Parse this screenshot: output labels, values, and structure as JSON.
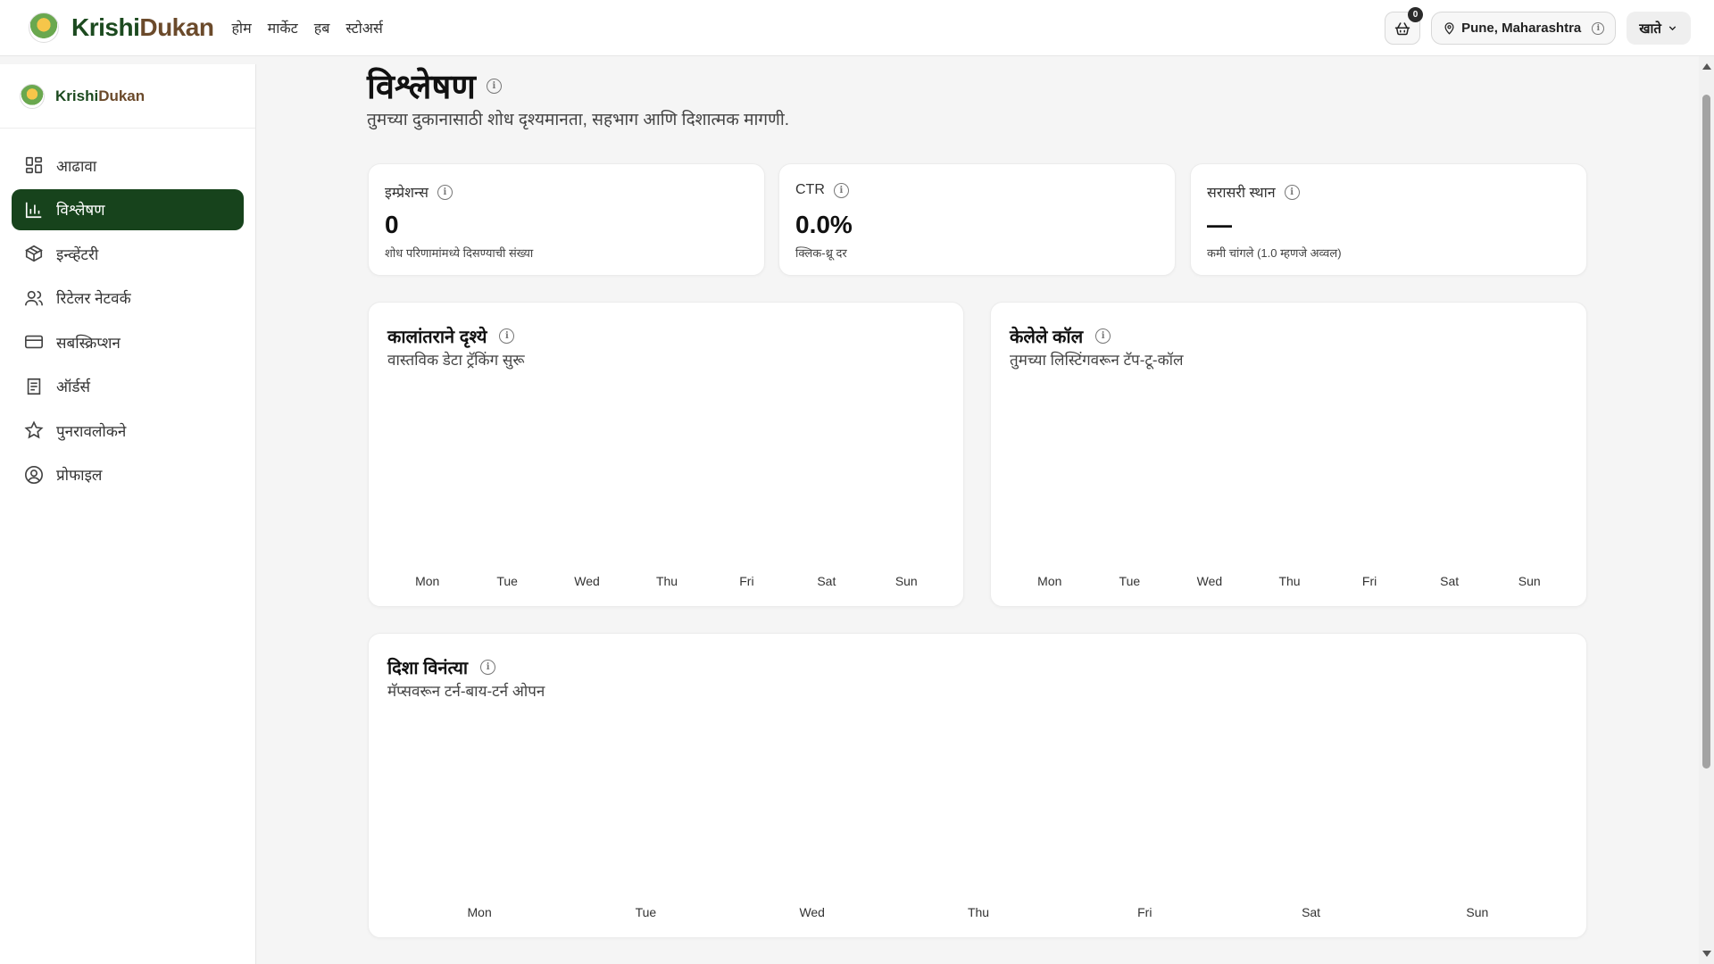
{
  "header": {
    "brand_krishi": "Krishi",
    "brand_dukan": "Dukan",
    "nav": [
      "होम",
      "मार्केट",
      "हब",
      "स्टोअर्स"
    ],
    "cart_count": "0",
    "location": "Pune, Maharashtra",
    "account_label": "खाते"
  },
  "sidebar": {
    "brand_krishi": "Krishi",
    "brand_dukan": "Dukan",
    "items": [
      {
        "label": "आढावा",
        "icon": "grid-icon"
      },
      {
        "label": "विश्लेषण",
        "icon": "bar-chart-icon",
        "active": true
      },
      {
        "label": "इन्व्हेंटरी",
        "icon": "box-icon"
      },
      {
        "label": "रिटेलर नेटवर्क",
        "icon": "users-icon"
      },
      {
        "label": "सबस्क्रिप्शन",
        "icon": "credit-card-icon"
      },
      {
        "label": "ऑर्डर्स",
        "icon": "document-icon"
      },
      {
        "label": "पुनरावलोकने",
        "icon": "star-icon"
      },
      {
        "label": "प्रोफाइल",
        "icon": "user-circle-icon"
      }
    ]
  },
  "page": {
    "title": "विश्लेषण",
    "subtitle": "तुमच्या दुकानासाठी शोध दृश्यमानता, सहभाग आणि दिशात्मक मागणी."
  },
  "stats": [
    {
      "label": "इम्प्रेशन्स",
      "value": "0",
      "note": "शोध परिणामांमध्ये दिसण्याची संख्या"
    },
    {
      "label": "CTR",
      "value": "0.0%",
      "note": "क्लिक-थ्रू दर"
    },
    {
      "label": "सरासरी स्थान",
      "value": "—",
      "note": "कमी चांगले (1.0 म्हणजे अव्वल)"
    }
  ],
  "chart_data": [
    {
      "type": "bar",
      "title": "कालांतराने दृश्ये",
      "subtitle": "वास्तविक डेटा ट्रॅकिंग सुरू",
      "categories": [
        "Mon",
        "Tue",
        "Wed",
        "Thu",
        "Fri",
        "Sat",
        "Sun"
      ],
      "values": [
        0,
        0,
        0,
        0,
        0,
        0,
        0
      ]
    },
    {
      "type": "bar",
      "title": "केलेले कॉल",
      "subtitle": "तुमच्या लिस्टिंगवरून टॅप-टू-कॉल",
      "categories": [
        "Mon",
        "Tue",
        "Wed",
        "Thu",
        "Fri",
        "Sat",
        "Sun"
      ],
      "values": [
        0,
        0,
        0,
        0,
        0,
        0,
        0
      ]
    },
    {
      "type": "bar",
      "title": "दिशा विनंत्या",
      "subtitle": "मॅप्सवरून टर्न-बाय-टर्न ओपन",
      "categories": [
        "Mon",
        "Tue",
        "Wed",
        "Thu",
        "Fri",
        "Sat",
        "Sun"
      ],
      "values": [
        0,
        0,
        0,
        0,
        0,
        0,
        0
      ]
    }
  ],
  "colors": {
    "active_bg": "#17431c",
    "brand_green": "#1c4a1f",
    "brand_brown": "#6b4a2b"
  }
}
